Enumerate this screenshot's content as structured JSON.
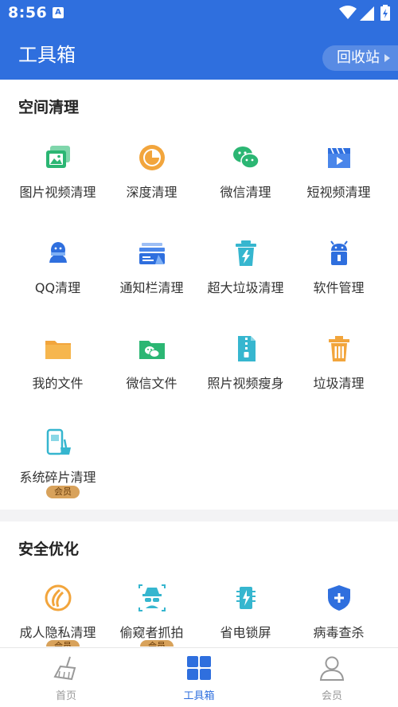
{
  "status": {
    "time": "8:56",
    "notif_glyph": "A"
  },
  "header": {
    "title": "工具箱",
    "recycle_label": "回收站"
  },
  "sections": {
    "space": {
      "title": "空间清理",
      "items": [
        {
          "label": "图片视频清理",
          "icon": "photo-video-icon"
        },
        {
          "label": "深度清理",
          "icon": "pie-chart-icon"
        },
        {
          "label": "微信清理",
          "icon": "wechat-icon"
        },
        {
          "label": "短视频清理",
          "icon": "clapper-icon"
        },
        {
          "label": "QQ清理",
          "icon": "qq-icon"
        },
        {
          "label": "通知栏清理",
          "icon": "notification-sweep-icon"
        },
        {
          "label": "超大垃圾清理",
          "icon": "bin-bolt-icon"
        },
        {
          "label": "软件管理",
          "icon": "android-icon"
        },
        {
          "label": "我的文件",
          "icon": "folder-icon"
        },
        {
          "label": "微信文件",
          "icon": "wechat-folder-icon"
        },
        {
          "label": "照片视频瘦身",
          "icon": "zip-file-icon"
        },
        {
          "label": "垃圾清理",
          "icon": "trash-icon"
        },
        {
          "label": "系统碎片清理",
          "icon": "phone-broom-icon",
          "badge": "会员"
        }
      ]
    },
    "security": {
      "title": "安全优化",
      "items": [
        {
          "label": "成人隐私清理",
          "icon": "privacy-icon",
          "badge": "会员"
        },
        {
          "label": "偷窥者抓拍",
          "icon": "spy-icon",
          "badge": "会员"
        },
        {
          "label": "省电锁屏",
          "icon": "battery-lock-icon"
        },
        {
          "label": "病毒查杀",
          "icon": "shield-plus-icon"
        }
      ]
    }
  },
  "tabs": [
    {
      "label": "首页",
      "icon": "broom-icon",
      "active": false
    },
    {
      "label": "工具箱",
      "icon": "grid-icon",
      "active": true
    },
    {
      "label": "会员",
      "icon": "user-icon",
      "active": false
    }
  ],
  "colors": {
    "brand": "#2f6fde",
    "green": "#2bb673",
    "orange": "#f2a53c",
    "teal": "#36b6cf",
    "gold_badge": "#d8a25b"
  }
}
